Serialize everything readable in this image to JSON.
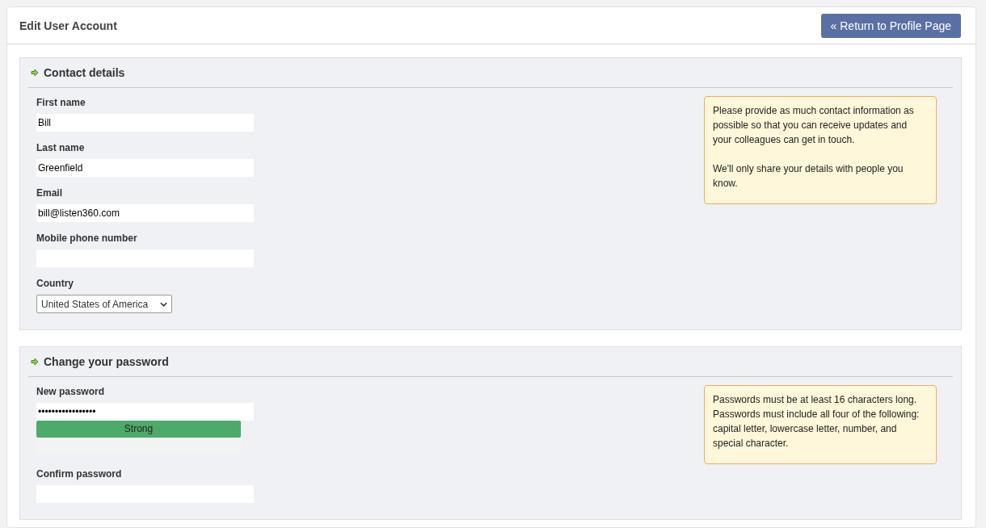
{
  "page": {
    "title": "Edit User Account",
    "return_button": "« Return to Profile Page"
  },
  "sections": [
    {
      "title": "Contact details",
      "fields": [
        {
          "kind": "text",
          "label": "First name",
          "value": "Bill"
        },
        {
          "kind": "text",
          "label": "Last name",
          "value": "Greenfield"
        },
        {
          "kind": "text",
          "label": "Email",
          "value": "bill@listen360.com"
        },
        {
          "kind": "text",
          "label": "Mobile phone number"
        },
        {
          "kind": "select",
          "label": "Country",
          "value": "United States of America"
        }
      ],
      "note": [
        "Please provide as much contact information as possible so that you can receive updates and your colleagues can get in touch.",
        "We'll only share your details with people you know."
      ]
    },
    {
      "title": "Change your password",
      "fields": [
        {
          "kind": "password",
          "label": "New password",
          "value": "•••••••••••••••••",
          "strength": {
            "label": "Strong",
            "level": 1
          }
        },
        {
          "kind": "password",
          "label": "Confirm password"
        }
      ],
      "note": [
        "Passwords must be at least 16 characters long. Passwords must include all four of the following: capital letter, lowercase letter, number, and special character."
      ]
    }
  ]
}
